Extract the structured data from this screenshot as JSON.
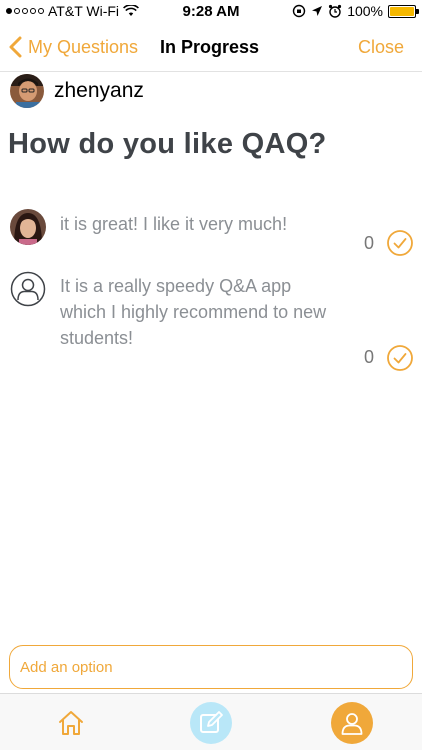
{
  "status_bar": {
    "carrier": "AT&T Wi-Fi",
    "time": "9:28 AM",
    "battery": "100%"
  },
  "nav": {
    "back_label": "My Questions",
    "title": "In Progress",
    "close_label": "Close"
  },
  "author": {
    "name": "zhenyanz"
  },
  "question": {
    "title": "How do you like QAQ?"
  },
  "options": [
    {
      "text": "it is great! I like it very much!",
      "count": "0"
    },
    {
      "text": "It is a really speedy Q&A app which I highly recommend to new students!",
      "count": "0"
    }
  ],
  "add_option": {
    "placeholder": "Add an option"
  },
  "colors": {
    "accent": "#f0a83a",
    "compose_bg": "#b9e7f8"
  }
}
